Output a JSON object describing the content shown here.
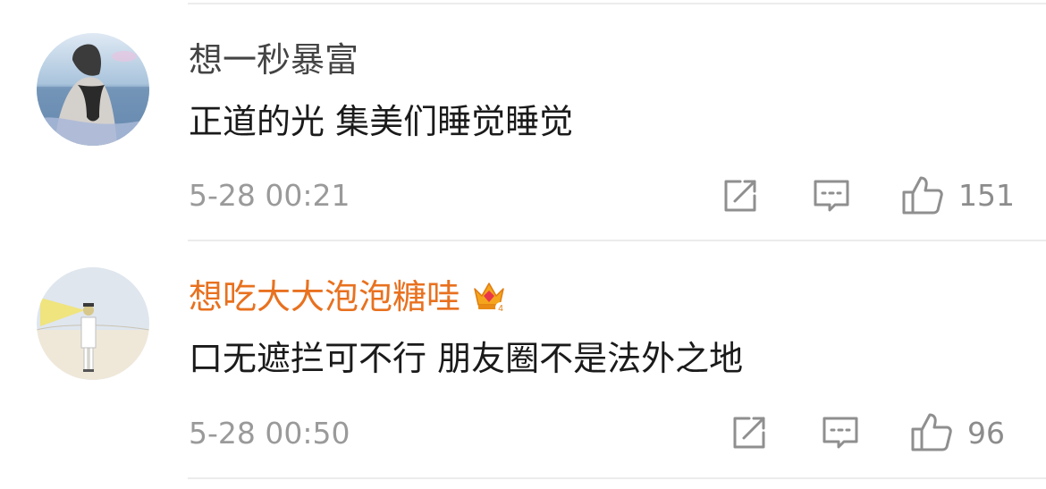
{
  "comments": [
    {
      "username": "想一秒暴富",
      "text": "正道的光 集美们睡觉睡觉",
      "time": "5-28 00:21",
      "likes": "151",
      "vip": false
    },
    {
      "username": "想吃大大泡泡糖哇",
      "text": "口无遮拦可不行 朋友圈不是法外之地",
      "time": "5-28 00:50",
      "likes": "96",
      "vip": true,
      "vip_badge_level": "4"
    }
  ],
  "colors": {
    "vip_name": "#e8711f",
    "name": "#444444",
    "text": "#1a1a1a",
    "meta": "#9a9a9a",
    "icon": "#8f8f8f"
  },
  "icons": [
    "share-icon",
    "reply-icon",
    "like-icon",
    "crown-vip-icon"
  ]
}
